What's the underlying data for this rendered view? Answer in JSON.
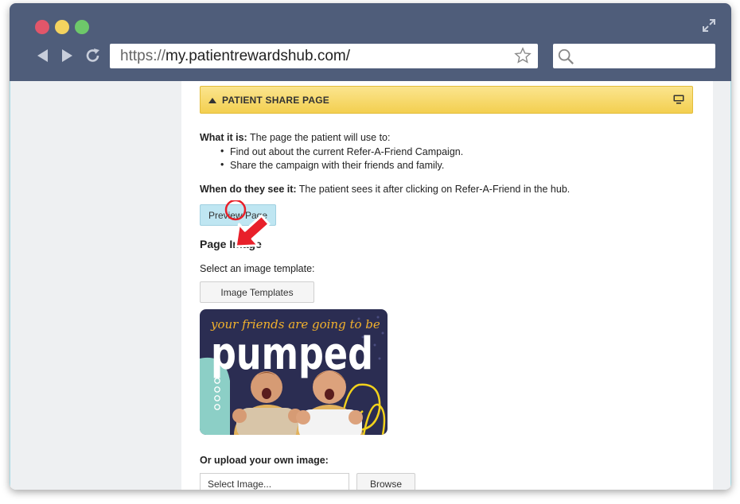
{
  "browser": {
    "url_protocol": "https://",
    "url_host": "my.patientrewardshub.com/"
  },
  "section": {
    "title": "PATIENT SHARE PAGE"
  },
  "description": {
    "what_label": "What it is:",
    "what_text": " The page the patient will use to:",
    "bullets": [
      "Find out about the current Refer-A-Friend Campaign.",
      "Share the campaign with their friends and family."
    ],
    "when_label": "When do they see it:",
    "when_text": " The patient sees it after clicking on Refer-A-Friend in the hub."
  },
  "preview_button": "Preview Page",
  "page_image": {
    "heading": "Page Image",
    "select_label": "Select an image template:",
    "templates_button": "Image Templates",
    "image_line1": "your friends are going to be",
    "image_line2": "pumped"
  },
  "upload": {
    "label": "Or upload your own image:",
    "input_value": "Select Image...",
    "browse_button": "Browse"
  },
  "colors": {
    "titlebar": "#4f5d7a",
    "header_yellow": "#f3cf4f",
    "preview_blue": "#bfe6f2",
    "arrow_red": "#e8202a"
  }
}
